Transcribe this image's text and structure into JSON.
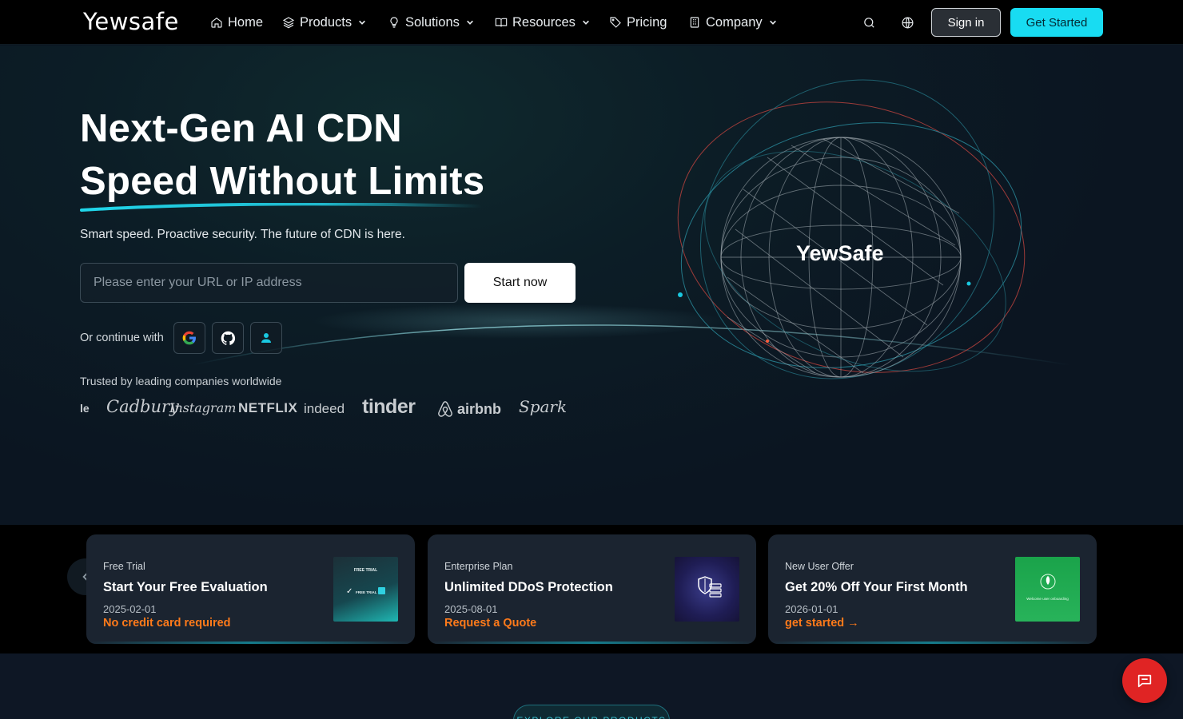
{
  "nav": {
    "logo": "Yewsafe",
    "items": [
      {
        "label": "Home",
        "icon": "home-icon",
        "dropdown": false
      },
      {
        "label": "Products",
        "icon": "layers-icon",
        "dropdown": true
      },
      {
        "label": "Solutions",
        "icon": "lightbulb-icon",
        "dropdown": true
      },
      {
        "label": "Resources",
        "icon": "book-icon",
        "dropdown": true
      },
      {
        "label": "Pricing",
        "icon": "tag-icon",
        "dropdown": false
      },
      {
        "label": "Company",
        "icon": "building-icon",
        "dropdown": true
      }
    ],
    "sign_in": "Sign in",
    "get_started": "Get Started"
  },
  "hero": {
    "title_line1": "Next-Gen AI CDN",
    "title_line2": "Speed Without Limits",
    "subtitle": "Smart speed. Proactive security. The future of CDN is here.",
    "url_placeholder": "Please enter your URL or IP address",
    "url_value": "",
    "start_button": "Start now",
    "continue_label": "Or continue with",
    "trusted_label": "Trusted by leading companies worldwide",
    "brands": [
      "le",
      "Cadbury",
      "Instagram",
      "NETFLIX",
      "indeed",
      "tinder",
      "airbnb",
      "Spark"
    ],
    "globe_label": "YewSafe"
  },
  "promos": [
    {
      "tag": "Free Trial",
      "title": "Start Your Free Evaluation",
      "date": "2025-02-01",
      "link": "No credit card required",
      "thumb_text_top": "FREE TRIAL",
      "thumb_text_mid": "FREE TRIAL"
    },
    {
      "tag": "Enterprise Plan",
      "title": "Unlimited DDoS Protection",
      "date": "2025-08-01",
      "link": "Request a Quote"
    },
    {
      "tag": "New User Offer",
      "title": "Get 20% Off Your First Month",
      "date": "2026-01-01",
      "link": "get started →",
      "thumb_text": "Welcome user onboarding"
    }
  ],
  "explore_label": "EXPLORE OUR PRODUCTS",
  "colors": {
    "accent": "#18dcf2",
    "promo_link": "#ff7a1a",
    "chat": "#e02424"
  }
}
